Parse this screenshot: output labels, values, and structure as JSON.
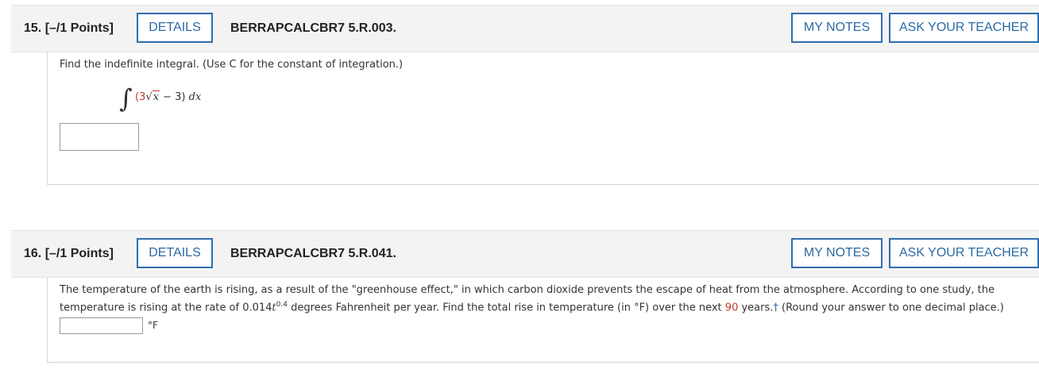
{
  "q15": {
    "number_label": "15.  [–/1 Points]",
    "details_label": "DETAILS",
    "code": "BERRAPCALCBR7 5.R.003.",
    "notes_label": "MY NOTES",
    "ask_label": "ASK YOUR TEACHER",
    "prompt": "Find the indefinite integral. (Use C for the constant of integration.)",
    "integral": {
      "sign": "∫",
      "open": "(3",
      "root": "√",
      "radicand": "x",
      "minus": " − 3)",
      "dx": " dx"
    },
    "answer_value": ""
  },
  "q16": {
    "number_label": "16.  [–/1 Points]",
    "details_label": "DETAILS",
    "code": "BERRAPCALCBR7 5.R.041.",
    "notes_label": "MY NOTES",
    "ask_label": "ASK YOUR TEACHER",
    "prompt_part1": "The temperature of the earth is rising, as a result of the \"greenhouse effect,\" in which carbon dioxide prevents the escape of heat from the atmosphere. According to one study, the temperature is rising at the rate of 0.014",
    "rate_var": "t",
    "rate_exp": "0.4",
    "prompt_part2": " degrees Fahrenheit per year. Find the total rise in temperature (in °F) over the next ",
    "years": "90",
    "prompt_part3": " years.",
    "dagger": "†",
    "prompt_part4": " (Round your answer to one decimal place.)",
    "answer_value": "",
    "unit": "°F"
  },
  "colors": {
    "accent": "#2f6fad",
    "highlight_red": "#c0392b",
    "header_bg": "#f3f3f3"
  }
}
